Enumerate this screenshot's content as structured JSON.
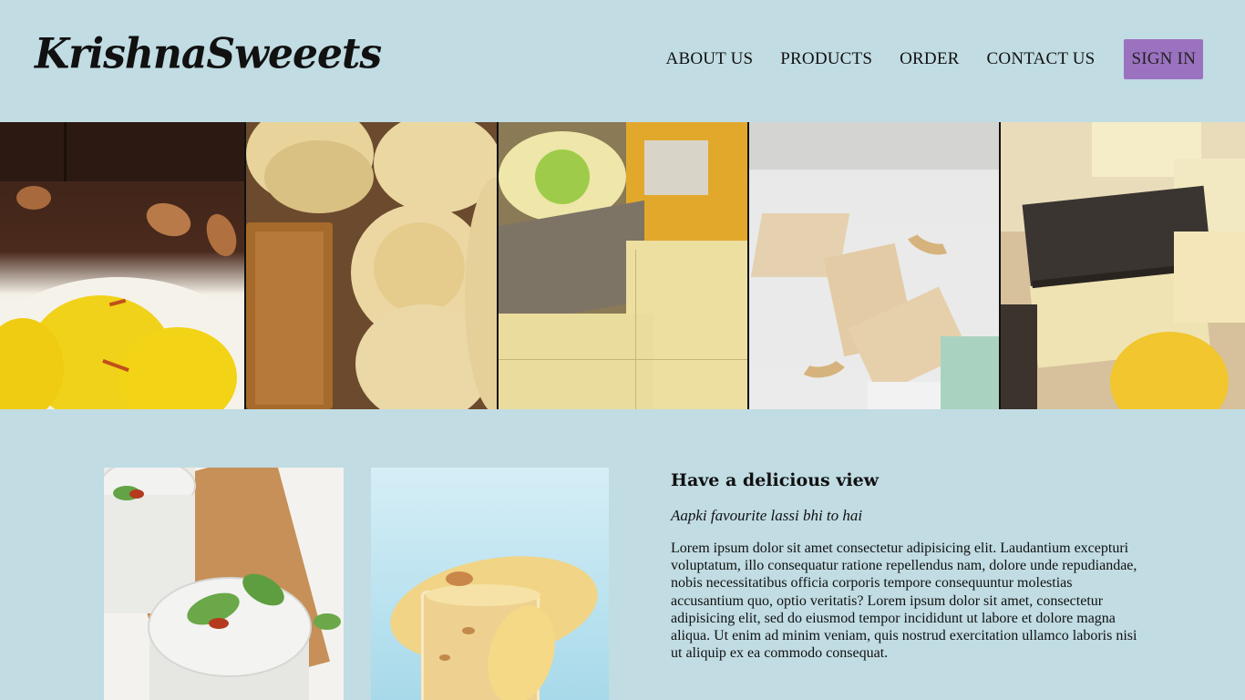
{
  "brand": {
    "logo_text": "KrishnaSweeets"
  },
  "nav": {
    "items": [
      {
        "label": "ABOUT US"
      },
      {
        "label": "PRODUCTS"
      },
      {
        "label": "ORDER"
      },
      {
        "label": "CONTACT US"
      }
    ],
    "signin_label": "SIGN IN"
  },
  "colors": {
    "page_bg": "#c1dce3",
    "signin_bg": "#9b72c0"
  },
  "hero": {
    "tiles": [
      {
        "icon": "rasgulla-kesar-image"
      },
      {
        "icon": "peda-image"
      },
      {
        "icon": "barfi-tray-image"
      },
      {
        "icon": "kaju-katli-image"
      },
      {
        "icon": "layered-barfi-image"
      }
    ]
  },
  "feature": {
    "title": "Have a delicious view",
    "subtitle": "Aapki favourite lassi bhi to hai",
    "body": "Lorem ipsum dolor sit amet consectetur adipisicing elit. Laudantium excepturi voluptatum, illo consequatur ratione repellendus nam, dolore unde repudiandae, nobis necessitatibus officia corporis tempore consequuntur molestias accusantium quo, optio veritatis? Lorem ipsum dolor sit amet, consectetur adipisicing elit, sed do eiusmod tempor incididunt ut labore et dolore magna aliqua. Ut enim ad minim veniam, quis nostrud exercitation ullamco laboris nisi ut aliquip ex ea commodo consequat.",
    "images": [
      {
        "icon": "sweet-lassi-glasses-image"
      },
      {
        "icon": "mango-lassi-splash-image"
      }
    ]
  }
}
